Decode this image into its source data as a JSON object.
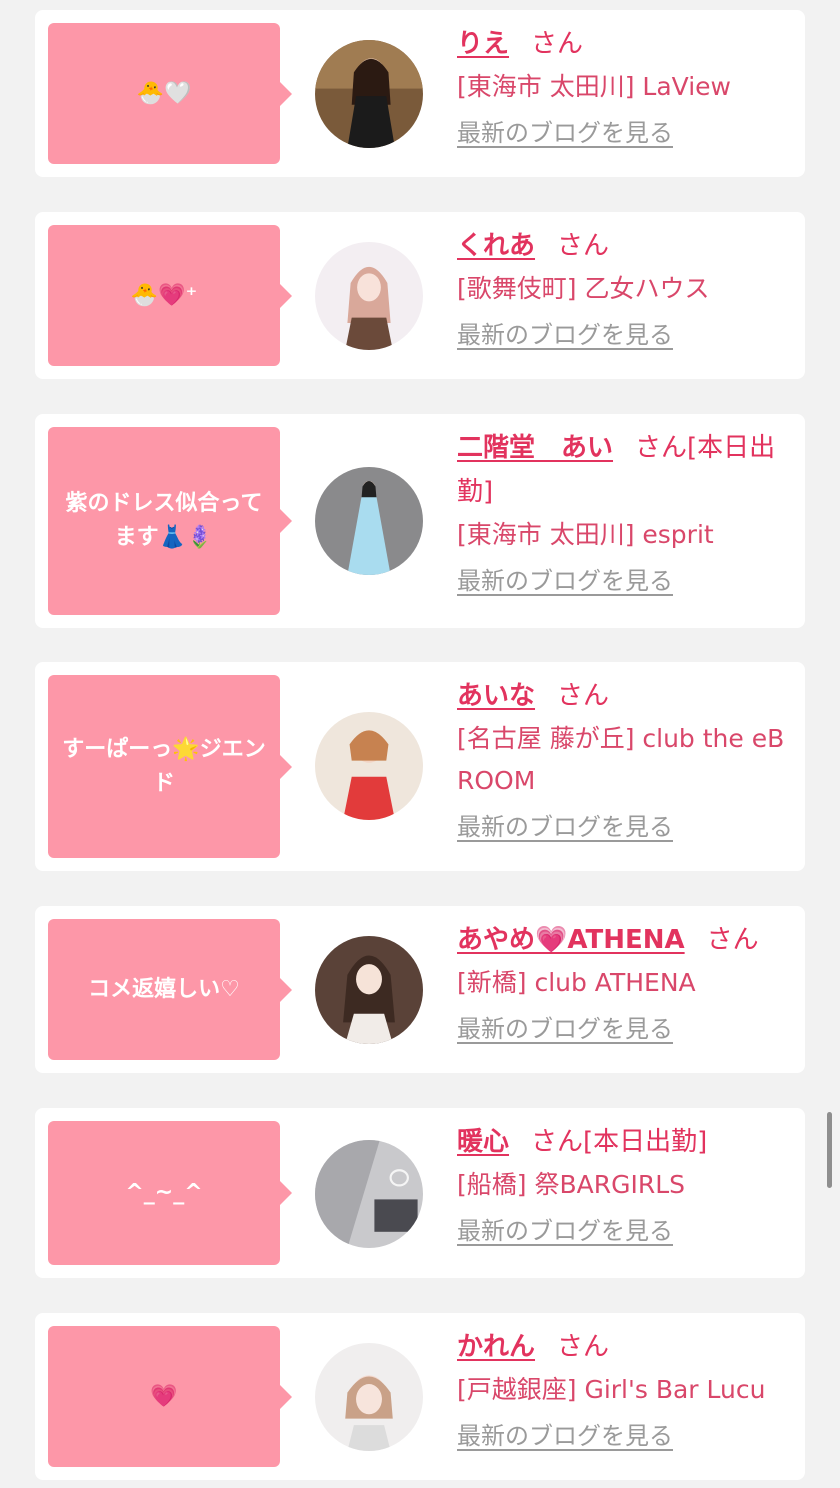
{
  "entries": [
    {
      "comment": "🐣🤍",
      "name": "りえ",
      "suffix": "さん",
      "location": "[東海市 太田川] LaView",
      "blog_link": "最新のブログを見る",
      "avatar": "woman-in-black-dress-photo"
    },
    {
      "comment": "🐣💗⁺",
      "name": "くれあ",
      "suffix": "さん",
      "location": "[歌舞伎町] 乙女ハウス",
      "blog_link": "最新のブログを見る",
      "avatar": "woman-pink-hair-photo"
    },
    {
      "comment": "紫のドレス似合ってます👗🪻",
      "name": "二階堂　あい",
      "suffix": "さん[本日出勤]",
      "location": "[東海市 太田川] esprit",
      "blog_link": "最新のブログを見る",
      "avatar": "woman-blue-dress-photo"
    },
    {
      "comment": "すーぱーっ🌟ジエンド",
      "name": "あいな",
      "suffix": "さん",
      "location": "[名古屋 藤が丘] club the eBROOM",
      "blog_link": "最新のブログを見る",
      "avatar": "woman-red-dress-photo"
    },
    {
      "comment": "コメ返嬉しい♡",
      "name": "あやめ💗ATHENA",
      "suffix": "さん",
      "location": "[新橋] club ATHENA",
      "blog_link": "最新のブログを見る",
      "avatar": "woman-white-outfit-photo"
    },
    {
      "comment": "^_~_^",
      "name": "暖心",
      "suffix": "さん[本日出勤]",
      "location": "[船橋] 祭BARGIRLS",
      "blog_link": "最新のブログを見る",
      "avatar": "room-photo"
    },
    {
      "comment": "💗",
      "name": "かれん",
      "suffix": "さん",
      "location": "[戸越銀座] Girl's Bar Lucu",
      "blog_link": "最新のブログを見る",
      "avatar": "woman-selfie-photo"
    }
  ],
  "colors": {
    "bubble": "#fd97a8",
    "name": "#e2335e",
    "text": "#d9476a",
    "link": "#9a9a9a",
    "background": "#f2f2f2"
  }
}
